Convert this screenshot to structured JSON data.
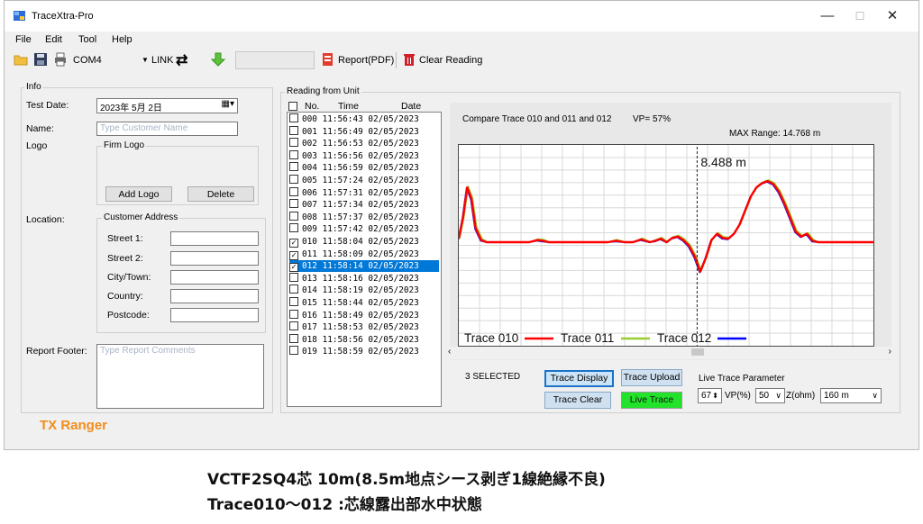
{
  "window": {
    "title": "TraceXtra-Pro",
    "controls": {
      "minimize": "—",
      "maximize": "☐",
      "close": "✕"
    }
  },
  "menu": [
    "File",
    "Edit",
    "Tool",
    "Help"
  ],
  "toolbar": {
    "port": "COM4",
    "link_label": "LINK",
    "report_pdf": "Report(PDF)",
    "clear_reading": "Clear Reading"
  },
  "info": {
    "group_title": "Info",
    "test_date_label": "Test Date:",
    "test_date_value": "2023年 5月 2日",
    "name_label": "Name:",
    "name_placeholder": "Type Customer Name",
    "logo_label": "Logo",
    "firm_logo_title": "Firm Logo",
    "add_logo": "Add Logo",
    "delete": "Delete",
    "location_label": "Location:",
    "address_title": "Customer Address",
    "street1": "Street 1:",
    "street2": "Street 2:",
    "city": "City/Town:",
    "country": "Country:",
    "postcode": "Postcode:",
    "footer_label": "Report Footer:",
    "footer_placeholder": "Type Report Comments"
  },
  "reading": {
    "group_title": "Reading from Unit",
    "headers": {
      "no": "No.",
      "time": "Time",
      "date": "Date"
    },
    "rows": [
      {
        "no": "000",
        "time": "11:56:43",
        "date": "02/05/2023",
        "checked": false,
        "selected": false
      },
      {
        "no": "001",
        "time": "11:56:49",
        "date": "02/05/2023",
        "checked": false,
        "selected": false
      },
      {
        "no": "002",
        "time": "11:56:53",
        "date": "02/05/2023",
        "checked": false,
        "selected": false
      },
      {
        "no": "003",
        "time": "11:56:56",
        "date": "02/05/2023",
        "checked": false,
        "selected": false
      },
      {
        "no": "004",
        "time": "11:56:59",
        "date": "02/05/2023",
        "checked": false,
        "selected": false
      },
      {
        "no": "005",
        "time": "11:57:24",
        "date": "02/05/2023",
        "checked": false,
        "selected": false
      },
      {
        "no": "006",
        "time": "11:57:31",
        "date": "02/05/2023",
        "checked": false,
        "selected": false
      },
      {
        "no": "007",
        "time": "11:57:34",
        "date": "02/05/2023",
        "checked": false,
        "selected": false
      },
      {
        "no": "008",
        "time": "11:57:37",
        "date": "02/05/2023",
        "checked": false,
        "selected": false
      },
      {
        "no": "009",
        "time": "11:57:42",
        "date": "02/05/2023",
        "checked": false,
        "selected": false
      },
      {
        "no": "010",
        "time": "11:58:04",
        "date": "02/05/2023",
        "checked": true,
        "selected": false
      },
      {
        "no": "011",
        "time": "11:58:09",
        "date": "02/05/2023",
        "checked": true,
        "selected": false
      },
      {
        "no": "012",
        "time": "11:58:14",
        "date": "02/05/2023",
        "checked": true,
        "selected": true
      },
      {
        "no": "013",
        "time": "11:58:16",
        "date": "02/05/2023",
        "checked": false,
        "selected": false
      },
      {
        "no": "014",
        "time": "11:58:19",
        "date": "02/05/2023",
        "checked": false,
        "selected": false
      },
      {
        "no": "015",
        "time": "11:58:44",
        "date": "02/05/2023",
        "checked": false,
        "selected": false
      },
      {
        "no": "016",
        "time": "11:58:49",
        "date": "02/05/2023",
        "checked": false,
        "selected": false
      },
      {
        "no": "017",
        "time": "11:58:53",
        "date": "02/05/2023",
        "checked": false,
        "selected": false
      },
      {
        "no": "018",
        "time": "11:58:56",
        "date": "02/05/2023",
        "checked": false,
        "selected": false
      },
      {
        "no": "019",
        "time": "11:58:59",
        "date": "02/05/2023",
        "checked": false,
        "selected": false
      }
    ],
    "selected_count": "3 SELECTED",
    "trace_display": "Trace Display",
    "trace_upload": "Trace Upload",
    "trace_clear": "Trace Clear",
    "live_trace": "Live Trace",
    "live_param_title": "Live Trace Parameter",
    "vp_value": "67",
    "vp_label": "VP(%)",
    "z_value": "50",
    "z_label": "Z(ohm)",
    "range_value": "160 m"
  },
  "chart_data": {
    "type": "line",
    "title": "Compare Trace 010 and 011 and 012",
    "vp_text": "VP= 57%",
    "max_range": "MAX Range: 14.768 m",
    "cursor_label": "8.488 m",
    "cursor_x": 8.488,
    "xlim": [
      0,
      14.768
    ],
    "ylim": [
      -1,
      1
    ],
    "grid": true,
    "legend_position": "bottom-left",
    "series": [
      {
        "name": "Trace 010",
        "color": "#ff0000"
      },
      {
        "name": "Trace 011",
        "color": "#9acd32"
      },
      {
        "name": "Trace 012",
        "color": "#0000ff"
      }
    ],
    "x": [
      0,
      0.15,
      0.3,
      0.45,
      0.6,
      0.8,
      1.0,
      1.2,
      1.5,
      2.0,
      2.5,
      2.8,
      3.0,
      3.2,
      3.5,
      4.0,
      4.5,
      4.8,
      5.0,
      5.3,
      5.6,
      5.9,
      6.2,
      6.5,
      6.8,
      7.0,
      7.2,
      7.4,
      7.6,
      7.8,
      8.0,
      8.2,
      8.4,
      8.6,
      8.8,
      9.0,
      9.2,
      9.4,
      9.6,
      9.8,
      10.0,
      10.2,
      10.4,
      10.6,
      10.8,
      11.0,
      11.2,
      11.4,
      11.6,
      11.8,
      12.0,
      12.2,
      12.4,
      12.6,
      12.8,
      13.0,
      13.5,
      14.0,
      14.768
    ],
    "values": [
      0.05,
      0.35,
      0.78,
      0.62,
      0.2,
      0.03,
      0.0,
      0.0,
      0.0,
      0.0,
      0.0,
      0.03,
      0.02,
      0.0,
      0.0,
      0.0,
      0.0,
      0.0,
      0.0,
      0.0,
      0.02,
      0.0,
      0.0,
      0.04,
      0.0,
      0.02,
      0.05,
      0.0,
      0.06,
      0.08,
      0.03,
      -0.05,
      -0.2,
      -0.42,
      -0.22,
      0.03,
      0.12,
      0.06,
      0.05,
      0.12,
      0.25,
      0.45,
      0.65,
      0.78,
      0.84,
      0.87,
      0.83,
      0.72,
      0.55,
      0.35,
      0.15,
      0.08,
      0.12,
      0.02,
      0.0,
      0.0,
      0.0,
      0.0,
      0.0
    ]
  },
  "footer_brand": "TX Ranger",
  "caption_line1": "VCTF2SQ4芯 10m(8.5m地点シース剥ぎ1線絶縁不良)",
  "caption_line2": "Trace010～012 :芯線露出部水中状態"
}
